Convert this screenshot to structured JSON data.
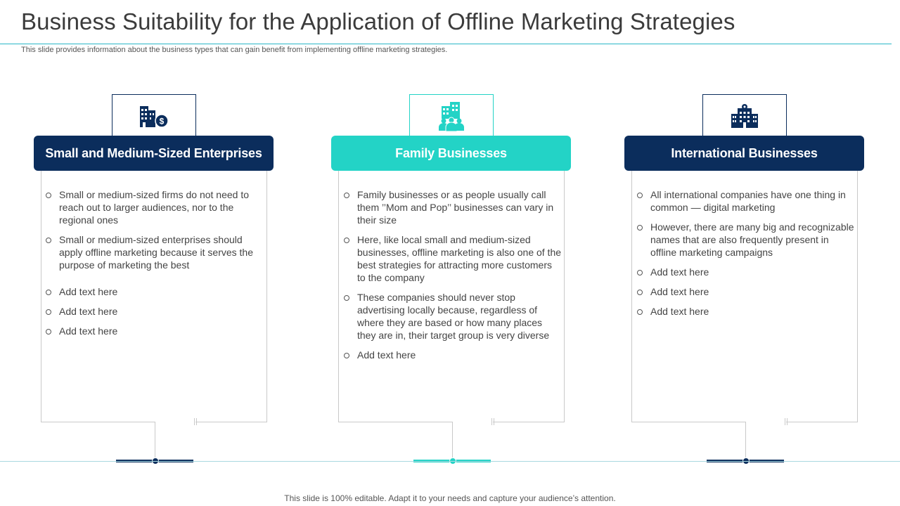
{
  "title": "Business Suitability for the Application of Offline Marketing Strategies",
  "subtitle": "This slide provides information about the business types that can gain benefit from implementing offline marketing strategies.",
  "columns": [
    {
      "icon": "building-dollar-icon",
      "heading": "Small and Medium-Sized Enterprises",
      "bullets": [
        "Small or medium-sized firms do not need to reach out to larger audiences, nor to the regional ones",
        "Small or medium-sized enterprises should apply offline marketing because it serves the purpose of marketing the best",
        "Add text here",
        "Add text here",
        "Add text here"
      ]
    },
    {
      "icon": "building-people-icon",
      "heading": "Family Businesses",
      "bullets": [
        "Family businesses or as people usually call them ’’Mom and Pop’’ businesses can vary in their size",
        "Here, like local small and medium-sized businesses, offline marketing is also one of the best strategies for attracting more customers to the company",
        "These companies should never stop advertising locally because, regardless of where they are based or how many places they are in, their target group is very diverse",
        "Add text here"
      ]
    },
    {
      "icon": "office-building-icon",
      "heading": "International Businesses",
      "bullets": [
        "All international companies have one thing in common — digital marketing",
        "However, there are many big and recognizable names that are also frequently present in offline marketing campaigns",
        "Add text here",
        "Add text here",
        "Add text here"
      ]
    }
  ],
  "colors": {
    "navy": "#0b2d5c",
    "teal": "#23d3c6"
  },
  "footer": "This slide is 100% editable. Adapt it to your needs and capture your audience’s attention."
}
